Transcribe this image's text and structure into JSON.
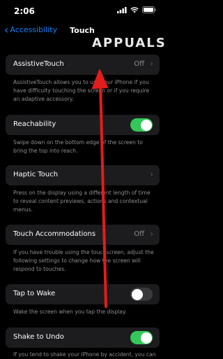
{
  "status": {
    "time": "2:06"
  },
  "nav": {
    "back_label": "Accessibility",
    "title": "Touch"
  },
  "watermark": {
    "text": "APPUALS"
  },
  "rows": [
    {
      "label": "AssistiveTouch",
      "value": "Off",
      "footer": "AssistiveTouch allows you to use your iPhone if you have difficulty touching the screen or if you require an adaptive accessory."
    },
    {
      "label": "Reachability",
      "toggle": "on",
      "footer": "Swipe down on the bottom edge of the screen to bring the top into reach."
    },
    {
      "label": "Haptic Touch",
      "footer": "Press on the display using a different length of time to reveal content previews, actions and contextual menus."
    },
    {
      "label": "Touch Accommodations",
      "value": "Off",
      "footer": "If you have trouble using the touchscreen, adjust the following settings to change how the screen will respond to touches."
    },
    {
      "label": "Tap to Wake",
      "toggle": "off",
      "footer": "Wake the screen when you tap the display."
    },
    {
      "label": "Shake to Undo",
      "toggle": "on",
      "footer": "If you tend to shake your iPhone by accident, you can"
    }
  ],
  "colors": {
    "accent": "#0a84ff",
    "toggle_on": "#34c759",
    "annotation_arrow": "#e31c1c"
  }
}
